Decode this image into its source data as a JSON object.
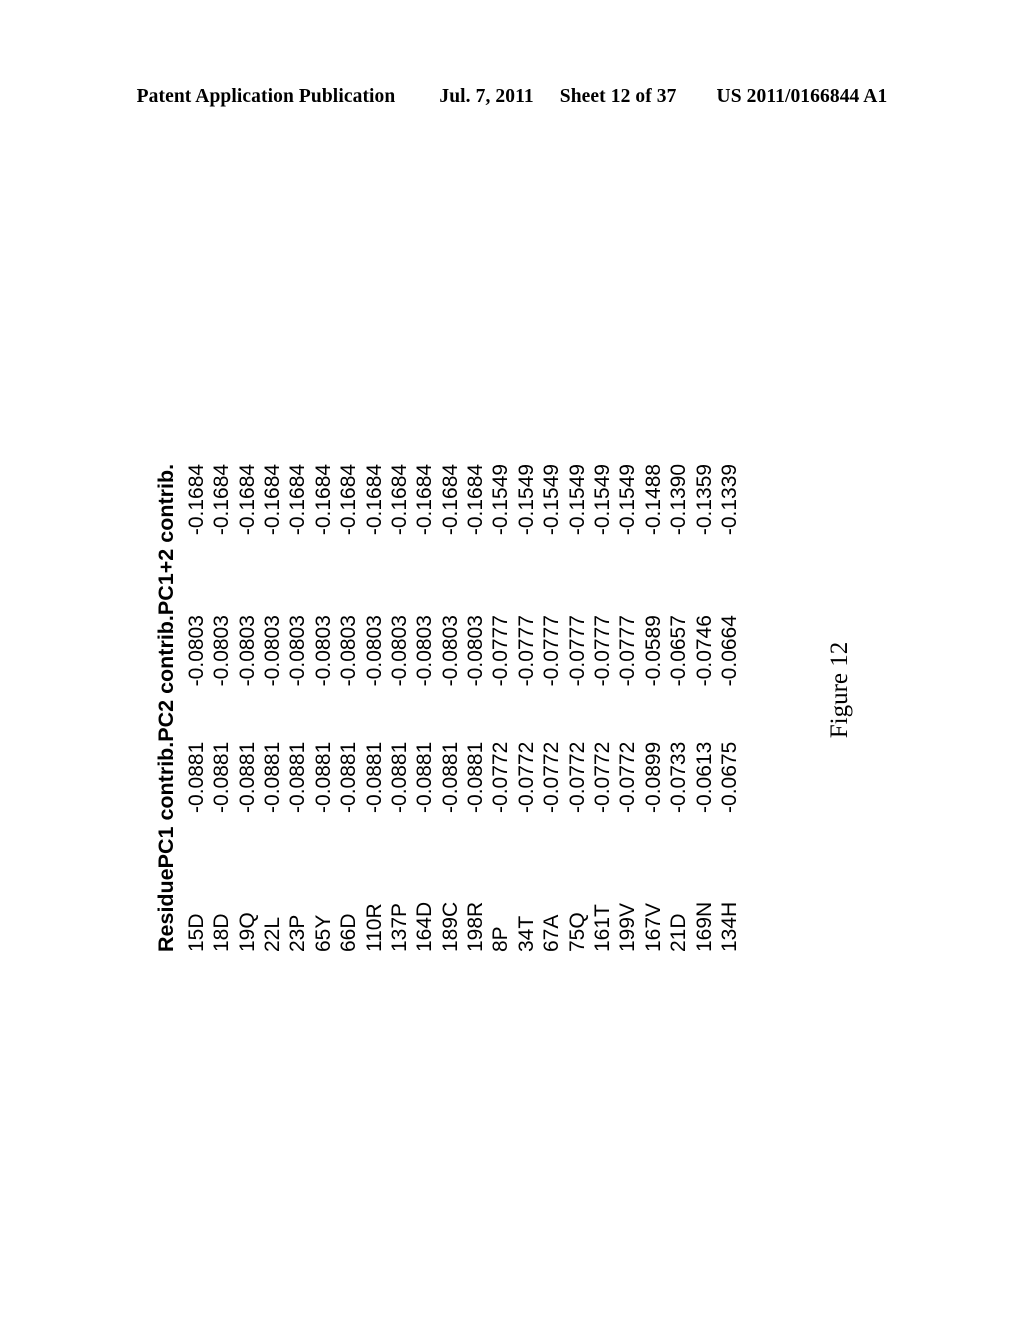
{
  "header": {
    "publication": "Patent Application Publication",
    "date": "Jul. 7, 2011",
    "sheet": "Sheet 12 of 37",
    "number": "US 2011/0166844 A1"
  },
  "figure": {
    "caption": "Figure 12"
  },
  "chart_data": {
    "type": "table",
    "title": "Figure 12",
    "columns": [
      "Residue",
      "PC1 contrib.",
      "PC2 contrib.",
      "PC1+2 contrib."
    ],
    "rows": [
      [
        "15D",
        "-0.0881",
        "-0.0803",
        "-0.1684"
      ],
      [
        "18D",
        "-0.0881",
        "-0.0803",
        "-0.1684"
      ],
      [
        "19Q",
        "-0.0881",
        "-0.0803",
        "-0.1684"
      ],
      [
        "22L",
        "-0.0881",
        "-0.0803",
        "-0.1684"
      ],
      [
        "23P",
        "-0.0881",
        "-0.0803",
        "-0.1684"
      ],
      [
        "65Y",
        "-0.0881",
        "-0.0803",
        "-0.1684"
      ],
      [
        "66D",
        "-0.0881",
        "-0.0803",
        "-0.1684"
      ],
      [
        "110R",
        "-0.0881",
        "-0.0803",
        "-0.1684"
      ],
      [
        "137P",
        "-0.0881",
        "-0.0803",
        "-0.1684"
      ],
      [
        "164D",
        "-0.0881",
        "-0.0803",
        "-0.1684"
      ],
      [
        "189C",
        "-0.0881",
        "-0.0803",
        "-0.1684"
      ],
      [
        "198R",
        "-0.0881",
        "-0.0803",
        "-0.1684"
      ],
      [
        "8P",
        "-0.0772",
        "-0.0777",
        "-0.1549"
      ],
      [
        "34T",
        "-0.0772",
        "-0.0777",
        "-0.1549"
      ],
      [
        "67A",
        "-0.0772",
        "-0.0777",
        "-0.1549"
      ],
      [
        "75Q",
        "-0.0772",
        "-0.0777",
        "-0.1549"
      ],
      [
        "161T",
        "-0.0772",
        "-0.0777",
        "-0.1549"
      ],
      [
        "199V",
        "-0.0772",
        "-0.0777",
        "-0.1549"
      ],
      [
        "167V",
        "-0.0899",
        "-0.0589",
        "-0.1488"
      ],
      [
        "21D",
        "-0.0733",
        "-0.0657",
        "-0.1390"
      ],
      [
        "169N",
        "-0.0613",
        "-0.0746",
        "-0.1359"
      ],
      [
        "134H",
        "-0.0675",
        "-0.0664",
        "-0.1339"
      ]
    ]
  }
}
